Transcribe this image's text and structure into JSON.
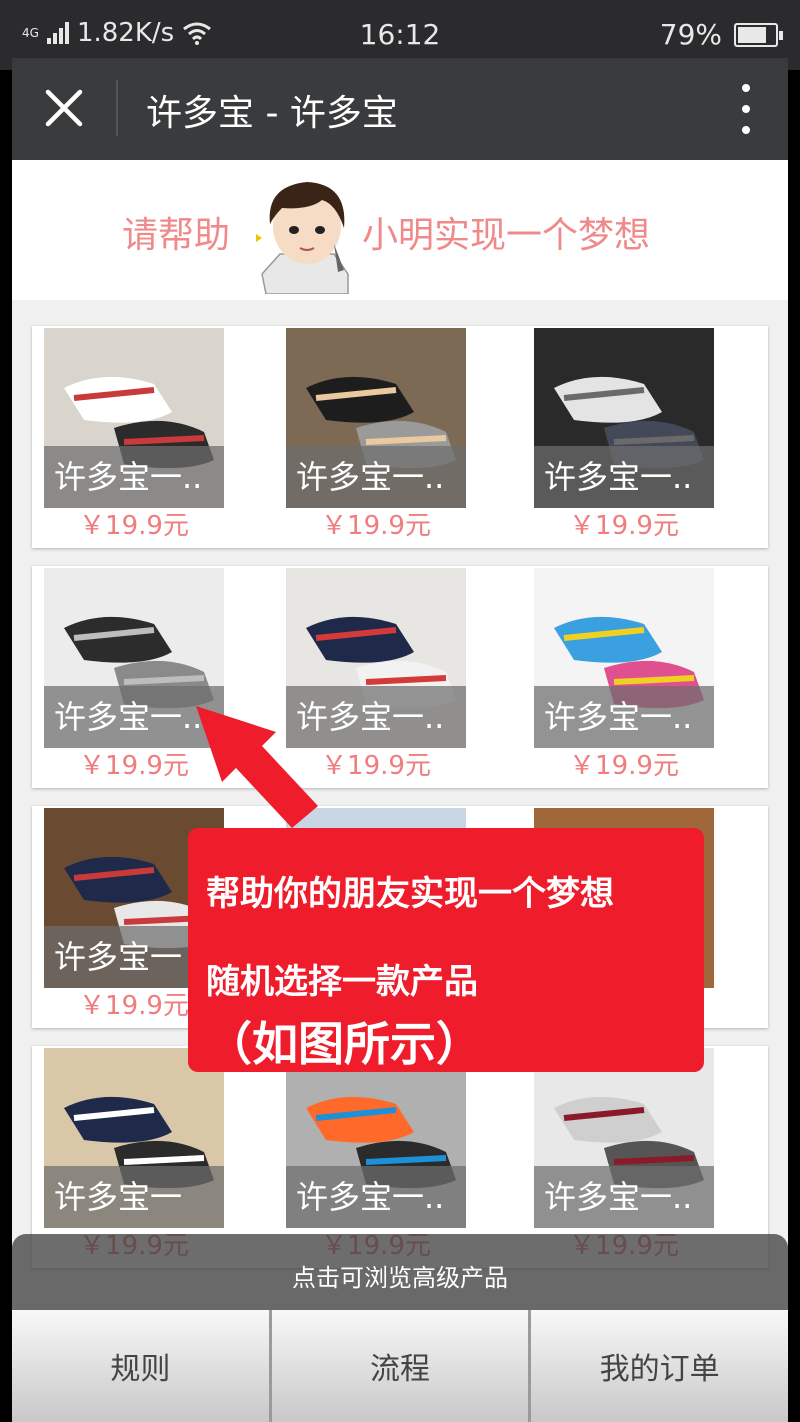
{
  "status_bar": {
    "network": "4G",
    "speed": "1.82K/s",
    "time": "16:12",
    "battery": "79%",
    "battery_level": 0.79
  },
  "title_bar": {
    "title": "许多宝 - 许多宝",
    "close_icon": "close-icon",
    "more_icon": "more-vertical-icon"
  },
  "banner": {
    "text_left": "请帮助",
    "text_right": "小明实现一个梦想"
  },
  "products": [
    {
      "caption": "许多宝一..",
      "price": "￥19.9元",
      "bg": "#d9d4cc",
      "sock": "#ffffff",
      "stripe": "#c93a3a",
      "dark": "#2b2b2b"
    },
    {
      "caption": "许多宝一..",
      "price": "￥19.9元",
      "bg": "#7d6a55",
      "sock": "#1d1d1d",
      "stripe": "#e8c9a0",
      "dark": "#9a9a9a"
    },
    {
      "caption": "许多宝一..",
      "price": "￥19.9元",
      "bg": "#2a2a2a",
      "sock": "#e4e4e4",
      "stripe": "#6a6a6a",
      "dark": "#44495a"
    },
    {
      "caption": "许多宝一..",
      "price": "￥19.9元",
      "bg": "#ececec",
      "sock": "#2c2c2c",
      "stripe": "#bdbdbd",
      "dark": "#8a8a8a"
    },
    {
      "caption": "许多宝一..",
      "price": "￥19.9元",
      "bg": "#e8e6e2",
      "sock": "#1f2a4a",
      "stripe": "#d43a3a",
      "dark": "#f2f2f2"
    },
    {
      "caption": "许多宝一..",
      "price": "￥19.9元",
      "bg": "#f4f4f4",
      "sock": "#3aa0e0",
      "stripe": "#f0d020",
      "dark": "#e05090"
    },
    {
      "caption": "许多宝一",
      "price": "￥19.9元",
      "bg": "#6a4a30",
      "sock": "#1f2a4a",
      "stripe": "#c93a3a",
      "dark": "#e8e8e8"
    },
    {
      "caption": "",
      "price": "",
      "bg": "#c9d6e4",
      "sock": "#ffffff",
      "stripe": "#cccccc",
      "dark": "#888888"
    },
    {
      "caption": "",
      "price": "",
      "bg": "#a0683a",
      "sock": "#2a2a2a",
      "stripe": "#d43a3a",
      "dark": "#ffffff"
    },
    {
      "caption": "许多宝一",
      "price": "￥19.9元",
      "bg": "#d8c8a8",
      "sock": "#1f2a4a",
      "stripe": "#ffffff",
      "dark": "#2b2b2b"
    },
    {
      "caption": "许多宝一..",
      "price": "￥19.9元",
      "bg": "#b0b0b0",
      "sock": "#ff6a2a",
      "stripe": "#1e90d8",
      "dark": "#2b2b2b"
    },
    {
      "caption": "许多宝一..",
      "price": "￥19.9元",
      "bg": "#e8e8e8",
      "sock": "#cfcfcf",
      "stripe": "#8a1a2a",
      "dark": "#555555"
    }
  ],
  "callout": {
    "line1": "帮助你的朋友实现一个梦想",
    "line2": "随机选择一款产品",
    "line3": "（如图所示）",
    "color": "#ef1d2c"
  },
  "hint": {
    "text": "点击可浏览高级产品"
  },
  "tabs": [
    {
      "label": "规则"
    },
    {
      "label": "流程"
    },
    {
      "label": "我的订单"
    }
  ],
  "colors": {
    "accent_pink": "#f08a8a",
    "price": "#f07d7d",
    "title_bar": "#3a3b3d"
  }
}
